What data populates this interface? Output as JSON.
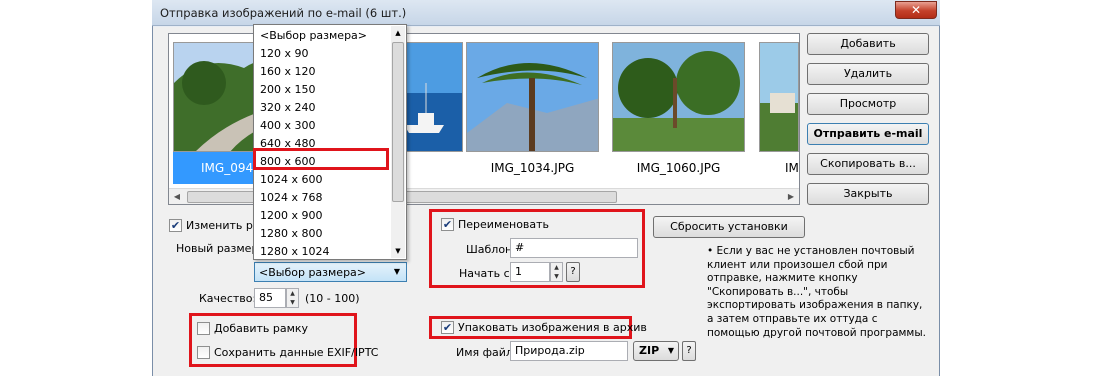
{
  "window": {
    "title": "Отправка изображений по e-mail (6 шт.)",
    "close_glyph": "✕"
  },
  "gallery": {
    "thumbnails": [
      {
        "caption": "IMG_0946.JPG",
        "selected": true
      },
      {
        "caption": ".JPG",
        "selected": false
      },
      {
        "caption": "IMG_1034.JPG",
        "selected": false
      },
      {
        "caption": "IMG_1060.JPG",
        "selected": false
      },
      {
        "caption": "IM",
        "selected": false
      }
    ]
  },
  "buttons": {
    "add": "Добавить",
    "remove": "Удалить",
    "preview": "Просмотр",
    "send": "Отправить e-mail",
    "copy": "Скопировать в...",
    "close": "Закрыть",
    "reset": "Сбросить установки"
  },
  "resize": {
    "checkbox_label": "Изменить разм",
    "checked": true,
    "new_size_label": "Новый размер:",
    "combo_value": "<Выбор размера>",
    "options": [
      "<Выбор размера>",
      "120 x 90",
      "160 x 120",
      "200 x 150",
      "320 x 240",
      "400 x 300",
      "640 x 480",
      "800 x 600",
      "1024 x 600",
      "1024 x 768",
      "1200 x 900",
      "1280 x 800",
      "1280 x 1024"
    ],
    "highlighted_option": "800 x 600"
  },
  "quality": {
    "label": "Качество:",
    "value": "85",
    "range": "(10 - 100)"
  },
  "frame": {
    "label": "Добавить рамку",
    "checked": false
  },
  "exif": {
    "label": "Сохранить данные EXIF/IPTC",
    "checked": false
  },
  "rename": {
    "label": "Переименовать",
    "checked": true,
    "template_label": "Шаблон:",
    "template_value": "#",
    "start_label": "Начать с:",
    "start_value": "1",
    "help": "?"
  },
  "archive": {
    "label": "Упаковать изображения в архив",
    "checked": true,
    "filename_label": "Имя файла:",
    "filename_value": "Природа.zip",
    "format": "ZIP",
    "help": "?"
  },
  "info_text": "• Если у вас не установлен почтовый клиент или произошел сбой при отправке, нажмите кнопку \"Скопировать в...\", чтобы экспортировать изображения в папку, а затем отправьте их оттуда с помощью другой почтовой программы.",
  "colors": {
    "selection": "#3399ff",
    "highlight_box": "#e0141b"
  }
}
